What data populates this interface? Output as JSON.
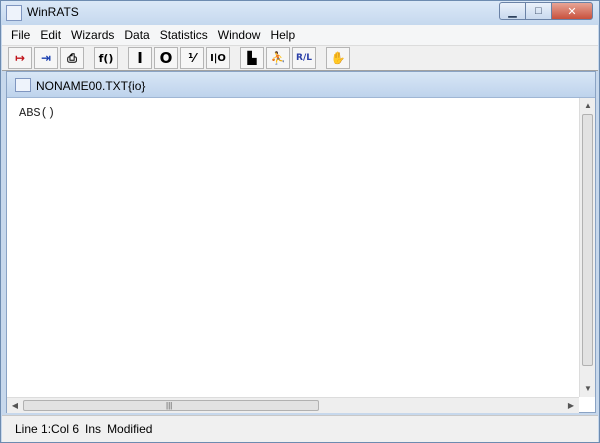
{
  "window": {
    "title": "WinRATS"
  },
  "menubar": {
    "items": [
      "File",
      "Edit",
      "Wizards",
      "Data",
      "Statistics",
      "Window",
      "Help"
    ]
  },
  "toolbar": {
    "buttons": [
      {
        "icon": "run-arrow-icon",
        "glyph": "↦"
      },
      {
        "icon": "import-arrow-icon",
        "glyph": "⇥"
      },
      {
        "icon": "print-icon",
        "glyph": "⎙"
      },
      {
        "icon": "function-icon",
        "glyph": "f()"
      },
      {
        "icon": "instruction-icon",
        "glyph": "I"
      },
      {
        "icon": "output-icon",
        "glyph": "O"
      },
      {
        "icon": "fraction-icon",
        "glyph": "⅟"
      },
      {
        "icon": "input-output-icon",
        "glyph": "I|O"
      },
      {
        "icon": "series-window-icon",
        "glyph": "▙"
      },
      {
        "icon": "runner-icon",
        "glyph": "⛹"
      },
      {
        "icon": "rl-icon",
        "glyph": "R/L"
      },
      {
        "icon": "wizard-icon",
        "glyph": "✋"
      }
    ]
  },
  "document": {
    "title": "NONAME00.TXT{io}",
    "content": "ABS()"
  },
  "scrollbar": {
    "grip": "|||"
  },
  "status": {
    "position": "Line 1:Col 6",
    "mode": "Ins",
    "state": "Modified"
  }
}
